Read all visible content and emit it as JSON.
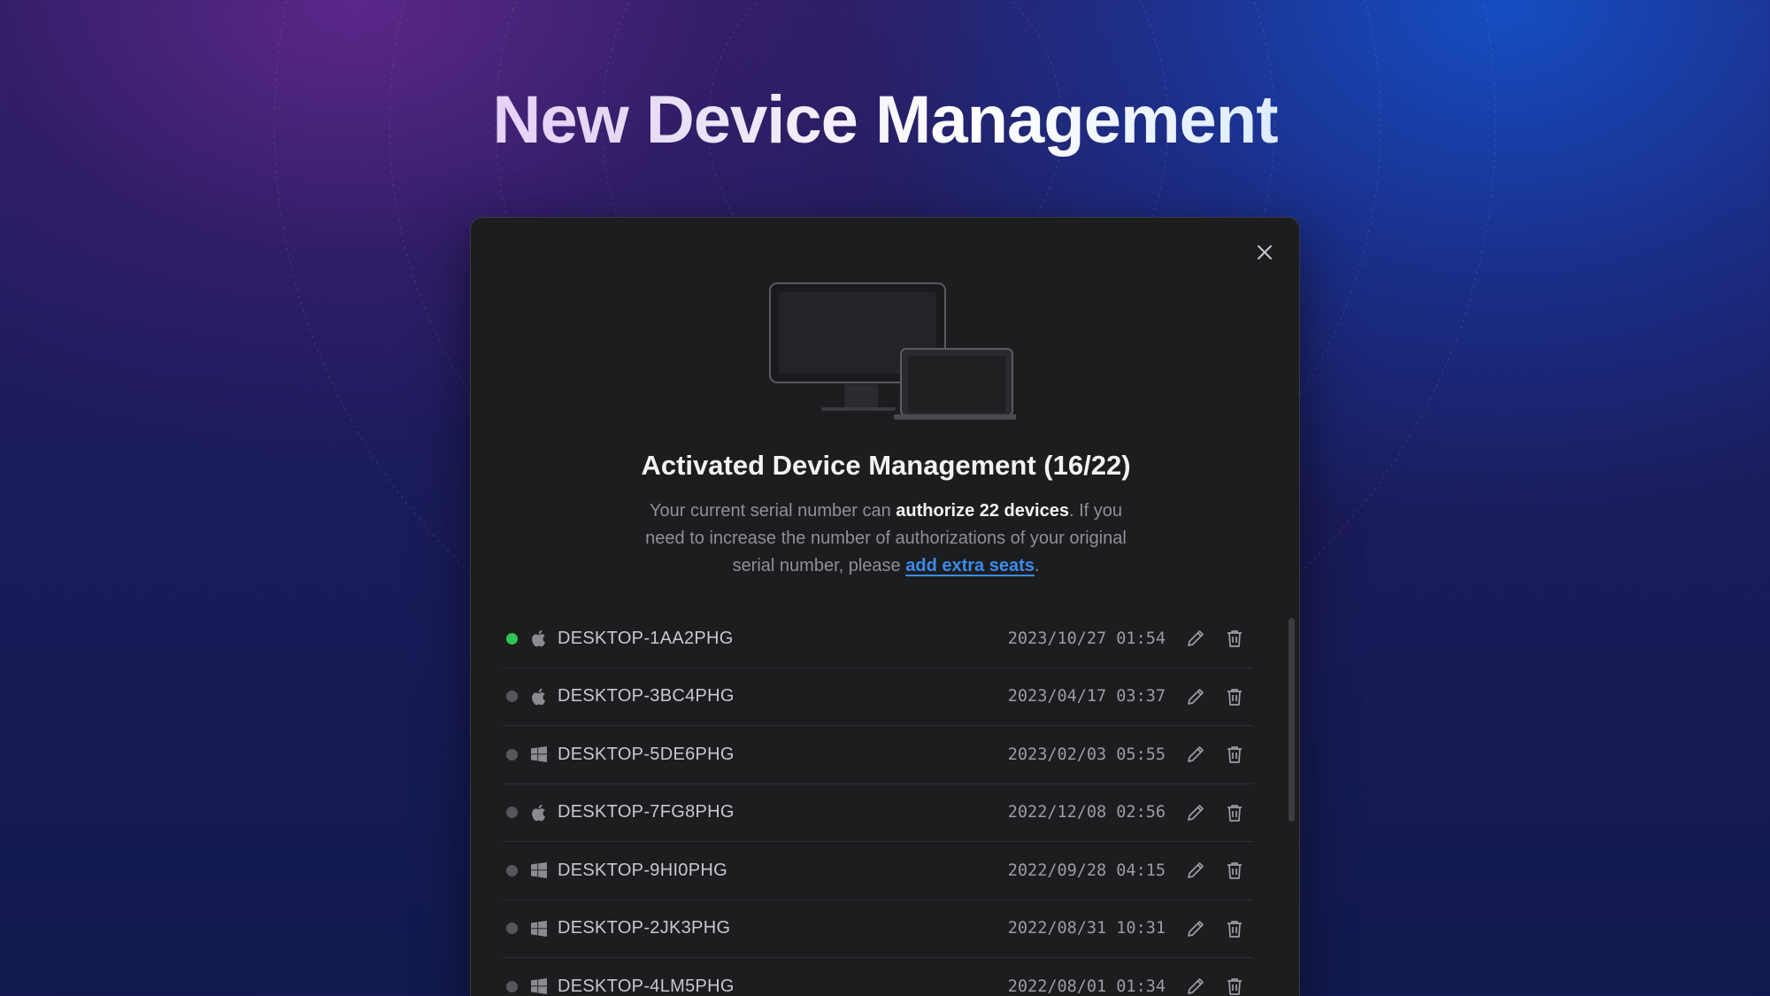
{
  "hero": {
    "title": "New Device Management"
  },
  "dialog": {
    "title": "Activated Device Management (16/22)",
    "description": {
      "part1": "Your current serial number can ",
      "bold": "authorize 22 devices",
      "part2": ". If you need to increase the number of authorizations of your original serial number, please ",
      "link": "add extra seats",
      "part3": "."
    },
    "close_icon": "close-icon",
    "devices": [
      {
        "name": "DESKTOP-1AA2PHG",
        "date": "2023/10/27 01:54",
        "os": "apple",
        "online": true
      },
      {
        "name": "DESKTOP-3BC4PHG",
        "date": "2023/04/17 03:37",
        "os": "apple",
        "online": false
      },
      {
        "name": "DESKTOP-5DE6PHG",
        "date": "2023/02/03 05:55",
        "os": "windows",
        "online": false
      },
      {
        "name": "DESKTOP-7FG8PHG",
        "date": "2022/12/08 02:56",
        "os": "apple",
        "online": false
      },
      {
        "name": "DESKTOP-9HI0PHG",
        "date": "2022/09/28 04:15",
        "os": "windows",
        "online": false
      },
      {
        "name": "DESKTOP-2JK3PHG",
        "date": "2022/08/31 10:31",
        "os": "windows",
        "online": false
      },
      {
        "name": "DESKTOP-4LM5PHG",
        "date": "2022/08/01 01:34",
        "os": "windows",
        "online": false
      }
    ]
  },
  "colors": {
    "online": "#2fc655",
    "offline": "#56575c",
    "link": "#3b8cf0"
  }
}
